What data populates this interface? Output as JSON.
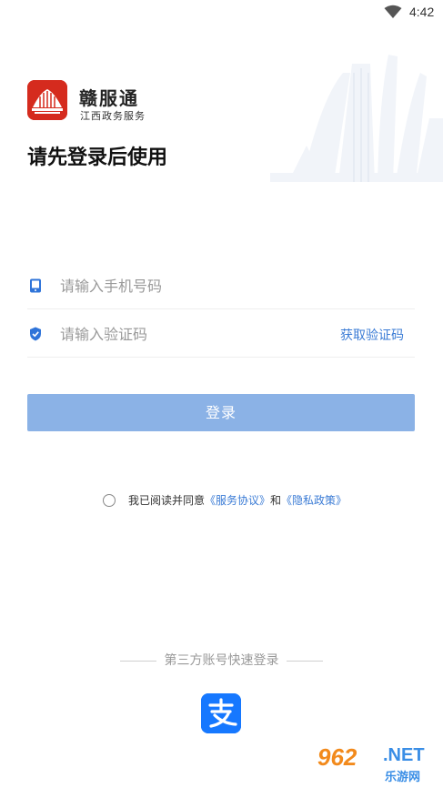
{
  "status_bar": {
    "time": "4:42",
    "wifi_icon": "wifi-icon"
  },
  "brand": {
    "name": "赣服通",
    "subtitle": "江西政务服务",
    "logo_icon": "ganfutong-logo-icon",
    "logo_color": "#d52b1e"
  },
  "page_title": "请先登录后使用",
  "form": {
    "phone_placeholder": "请输入手机号码",
    "phone_value": "",
    "phone_icon": "phone-icon",
    "code_placeholder": "请输入验证码",
    "code_value": "",
    "code_icon": "shield-icon",
    "get_code_label": "获取验证码"
  },
  "login_button_label": "登录",
  "agreement": {
    "checked": false,
    "prefix": "我已阅读并同意",
    "service_link": "《服务协议》",
    "and": "和",
    "privacy_link": "《隐私政策》"
  },
  "third_party": {
    "label": "第三方账号快速登录",
    "alipay_icon": "alipay-icon"
  },
  "watermark": {
    "number": "962",
    "net": ".NET",
    "text": "乐游网"
  },
  "colors": {
    "accent": "#3a7bd5",
    "login_button": "#8bb2e6",
    "alipay": "#1678ff"
  }
}
